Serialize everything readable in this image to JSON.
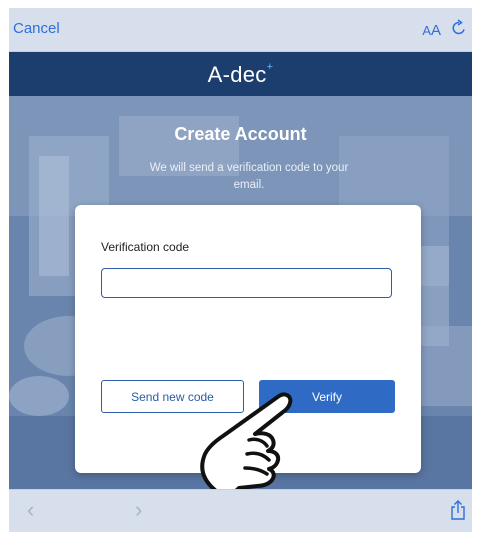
{
  "browser": {
    "cancel_label": "Cancel",
    "text_size_label_small": "A",
    "text_size_label_large": "A",
    "reload_icon": "reload-icon",
    "back_icon": "chevron-left-icon",
    "forward_icon": "chevron-right-icon",
    "share_icon": "share-icon"
  },
  "brand": {
    "name": "A-dec",
    "mark": "+"
  },
  "form": {
    "title": "Create Account",
    "subtitle": "We will send a verification code to your email.",
    "code_label": "Verification code",
    "code_value": "",
    "send_new_code_label": "Send new code",
    "verify_label": "Verify"
  },
  "colors": {
    "accent": "#2f6bc4",
    "brand_bar": "#1c3e6e",
    "toolbar": "#d7dfec"
  }
}
